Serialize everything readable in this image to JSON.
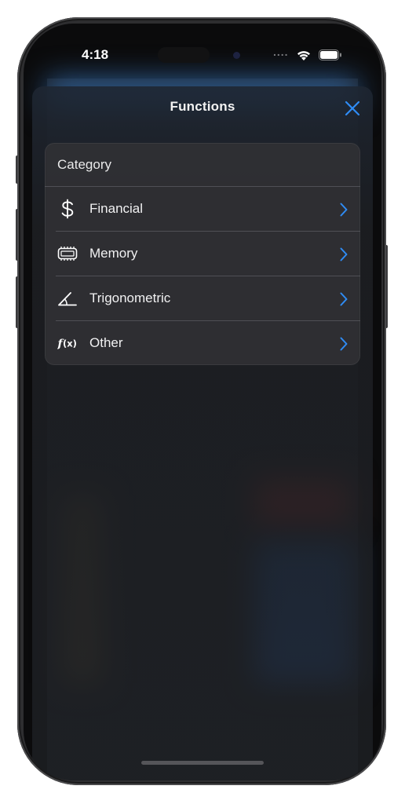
{
  "status_bar": {
    "time": "4:18",
    "signal": "....",
    "wifi_icon": "wifi-icon",
    "battery_icon": "battery-icon"
  },
  "sheet": {
    "title": "Functions",
    "close_icon": "close-x-icon"
  },
  "category": {
    "header": "Category",
    "items": [
      {
        "label": "Financial",
        "icon": "dollar-sign-icon"
      },
      {
        "label": "Memory",
        "icon": "memory-chip-icon"
      },
      {
        "label": "Trigonometric",
        "icon": "angle-icon"
      },
      {
        "label": "Other",
        "icon": "function-icon"
      }
    ]
  },
  "colors": {
    "accent": "#2f8cf5",
    "sheet_bg": "#1e2024",
    "card_bg": "#323236"
  }
}
